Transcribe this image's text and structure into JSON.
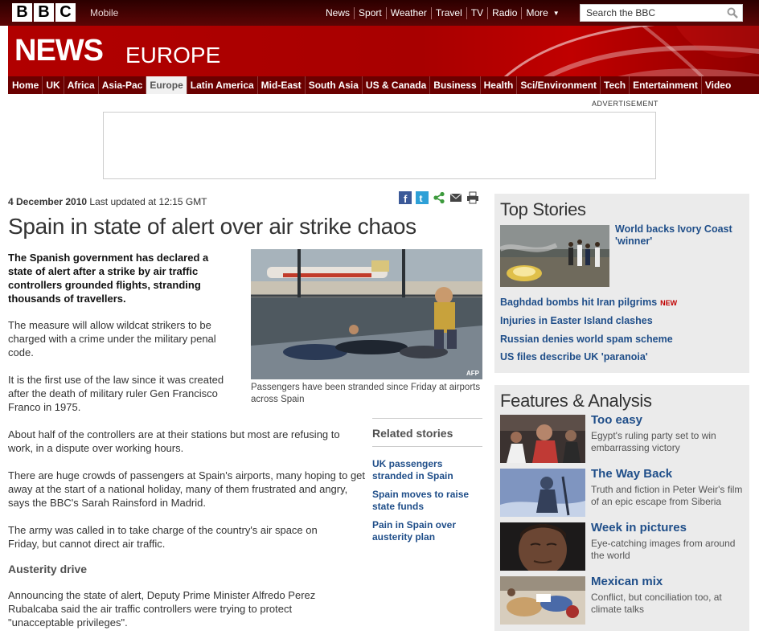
{
  "header": {
    "logo_letters": [
      "B",
      "B",
      "C"
    ],
    "mobile_label": "Mobile",
    "nav": [
      "News",
      "Sport",
      "Weather",
      "Travel",
      "TV",
      "Radio",
      "More"
    ],
    "search_placeholder": "Search the BBC",
    "masthead_news": "NEWS",
    "masthead_section": "EUROPE"
  },
  "section_nav": [
    "Home",
    "UK",
    "Africa",
    "Asia-Pac",
    "Europe",
    "Latin America",
    "Mid-East",
    "South Asia",
    "US & Canada",
    "Business",
    "Health",
    "Sci/Environment",
    "Tech",
    "Entertainment",
    "Video"
  ],
  "active_section": "Europe",
  "advert": {
    "label": "ADVERTISEMENT"
  },
  "article": {
    "date": "4 December 2010",
    "updated": "Last updated at 12:15 GMT",
    "share_icons": [
      "facebook-icon",
      "twitter-icon",
      "share-icon",
      "email-icon",
      "print-icon"
    ],
    "headline": "Spain in state of alert over air strike chaos",
    "intro": "The Spanish government has declared a state of alert after a strike by air traffic controllers grounded flights, stranding thousands of travellers.",
    "paragraphs": [
      "The measure will allow wildcat strikers to be charged with a crime under the military penal code.",
      "It is the first use of the law since it was created after the death of military ruler Gen Francisco Franco in 1975.",
      "About half of the controllers are at their stations but most are refusing to work, in a dispute over working hours.",
      "There are huge crowds of passengers at Spain's airports, many hoping to get away at the start of a national holiday, many of them frustrated and angry, says the BBC's Sarah Rainsford in Madrid.",
      "The army was called in to take charge of the country's air space on Friday, but cannot direct air traffic."
    ],
    "subhead": "Austerity drive",
    "after_subhead": "Announcing the state of alert, Deputy Prime Minister Alfredo Perez Rubalcaba said the air traffic controllers were trying to protect \"unacceptable privileges\".",
    "photo_credit": "AFP",
    "photo_caption": "Passengers have been stranded since Friday at airports across Spain"
  },
  "related": {
    "title": "Related stories",
    "links": [
      "UK passengers stranded in Spain",
      "Spain moves to raise state funds",
      "Pain in Spain over austerity plan"
    ]
  },
  "top_stories": {
    "title": "Top Stories",
    "lead": "World backs Ivory Coast 'winner'",
    "links": [
      {
        "text": "Baghdad bombs hit Iran pilgrims",
        "badge": "NEW"
      },
      {
        "text": "Injuries in Easter Island clashes",
        "badge": ""
      },
      {
        "text": "Russian denies world spam scheme",
        "badge": ""
      },
      {
        "text": "US files describe UK 'paranoia'",
        "badge": ""
      }
    ]
  },
  "features": {
    "title": "Features & Analysis",
    "items": [
      {
        "title": "Too easy",
        "text": "Egypt's ruling party set to win embarrassing victory"
      },
      {
        "title": "The Way Back",
        "text": "Truth and fiction in Peter Weir's film of an epic escape from Siberia"
      },
      {
        "title": "Week in pictures",
        "text": "Eye-catching images from around the world"
      },
      {
        "title": "Mexican mix",
        "text": "Conflict, but conciliation too, at climate talks"
      }
    ]
  },
  "colors": {
    "brand_red": "#b10000",
    "nav_dark_red": "#6b0000",
    "link_blue": "#1f4e89",
    "panel_grey": "#ebebeb"
  }
}
